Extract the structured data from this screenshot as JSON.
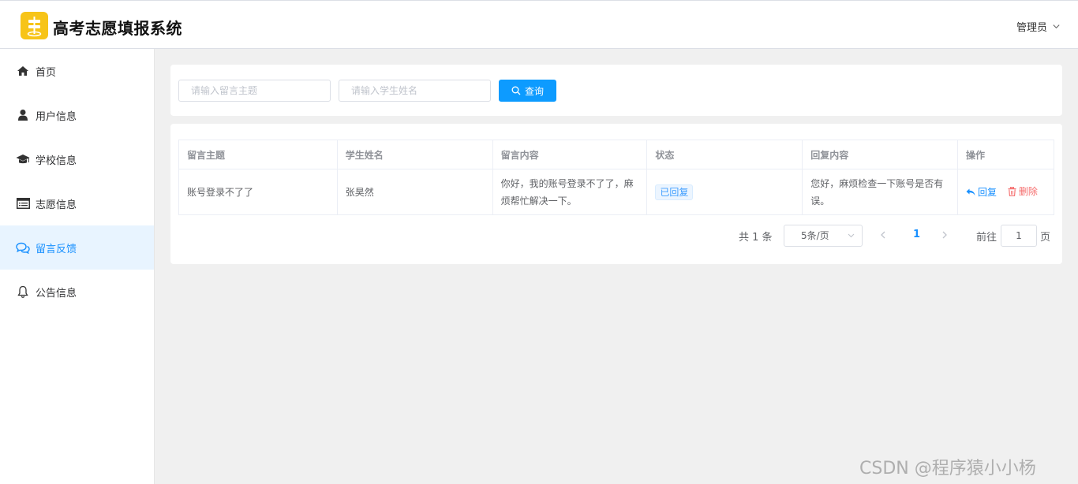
{
  "header": {
    "app_title": "高考志愿填报系统",
    "user_label": "管理员",
    "logo_icon": "signpost-icon",
    "logo_color": "#f7c418"
  },
  "sidebar": {
    "active_color": "#1890ff",
    "items": [
      {
        "label": "首页",
        "icon": "home-icon"
      },
      {
        "label": "用户信息",
        "icon": "user-icon"
      },
      {
        "label": "学校信息",
        "icon": "graduation-cap-icon"
      },
      {
        "label": "志愿信息",
        "icon": "list-icon"
      },
      {
        "label": "留言反馈",
        "icon": "chat-icon",
        "active": true
      },
      {
        "label": "公告信息",
        "icon": "bell-icon"
      }
    ]
  },
  "search": {
    "topic_placeholder": "请输入留言主题",
    "student_placeholder": "请输入学生姓名",
    "button_label": "查询"
  },
  "table": {
    "columns": [
      "留言主题",
      "学生姓名",
      "留言内容",
      "状态",
      "回复内容",
      "操作"
    ],
    "rows": [
      {
        "topic": "账号登录不了了",
        "student": "张昊然",
        "content": "你好，我的账号登录不了了，麻烦帮忙解决一下。",
        "status": "已回复",
        "reply": "您好，麻烦检查一下账号是否有误。",
        "actions": {
          "reply": "回复",
          "delete": "删除"
        }
      }
    ]
  },
  "pagination": {
    "total": "共 1 条",
    "page_size": "5条/页",
    "current_page": "1",
    "goto_label": "前往",
    "goto_value": "1",
    "page_suffix": "页"
  },
  "watermark": "CSDN @程序猿小小杨"
}
